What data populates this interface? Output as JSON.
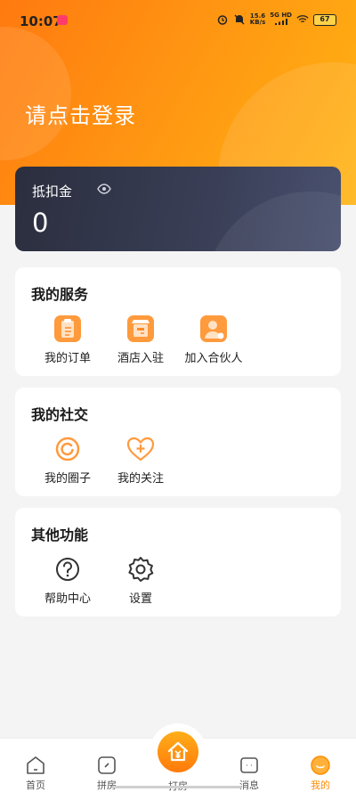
{
  "status_bar": {
    "time": "10:07",
    "net_speed": "15.6",
    "net_unit": "KB/s",
    "signal": "5G HD",
    "battery": "67"
  },
  "header": {
    "login_prompt": "请点击登录"
  },
  "credit": {
    "label": "抵扣金",
    "value": "0"
  },
  "services": {
    "title": "我的服务",
    "items": [
      {
        "label": "我的订单",
        "icon": "order-clipboard-icon"
      },
      {
        "label": "酒店入驻",
        "icon": "hotel-store-icon"
      },
      {
        "label": "加入合伙人",
        "icon": "partner-user-icon"
      }
    ]
  },
  "social": {
    "title": "我的社交",
    "items": [
      {
        "label": "我的圈子",
        "icon": "circle-icon"
      },
      {
        "label": "我的关注",
        "icon": "heart-plus-icon"
      }
    ]
  },
  "other": {
    "title": "其他功能",
    "items": [
      {
        "label": "帮助中心",
        "icon": "help-icon"
      },
      {
        "label": "设置",
        "icon": "gear-icon"
      }
    ]
  },
  "tabbar": {
    "tabs": [
      {
        "label": "首页",
        "icon": "home-icon"
      },
      {
        "label": "拼房",
        "icon": "share-room-icon"
      },
      {
        "label": "打房",
        "icon": "book-room-icon"
      },
      {
        "label": "消息",
        "icon": "message-icon"
      },
      {
        "label": "我的",
        "icon": "profile-smile-icon",
        "active": true
      }
    ]
  },
  "colors": {
    "accent": "#ff8a00",
    "credit_card": "#343849"
  }
}
